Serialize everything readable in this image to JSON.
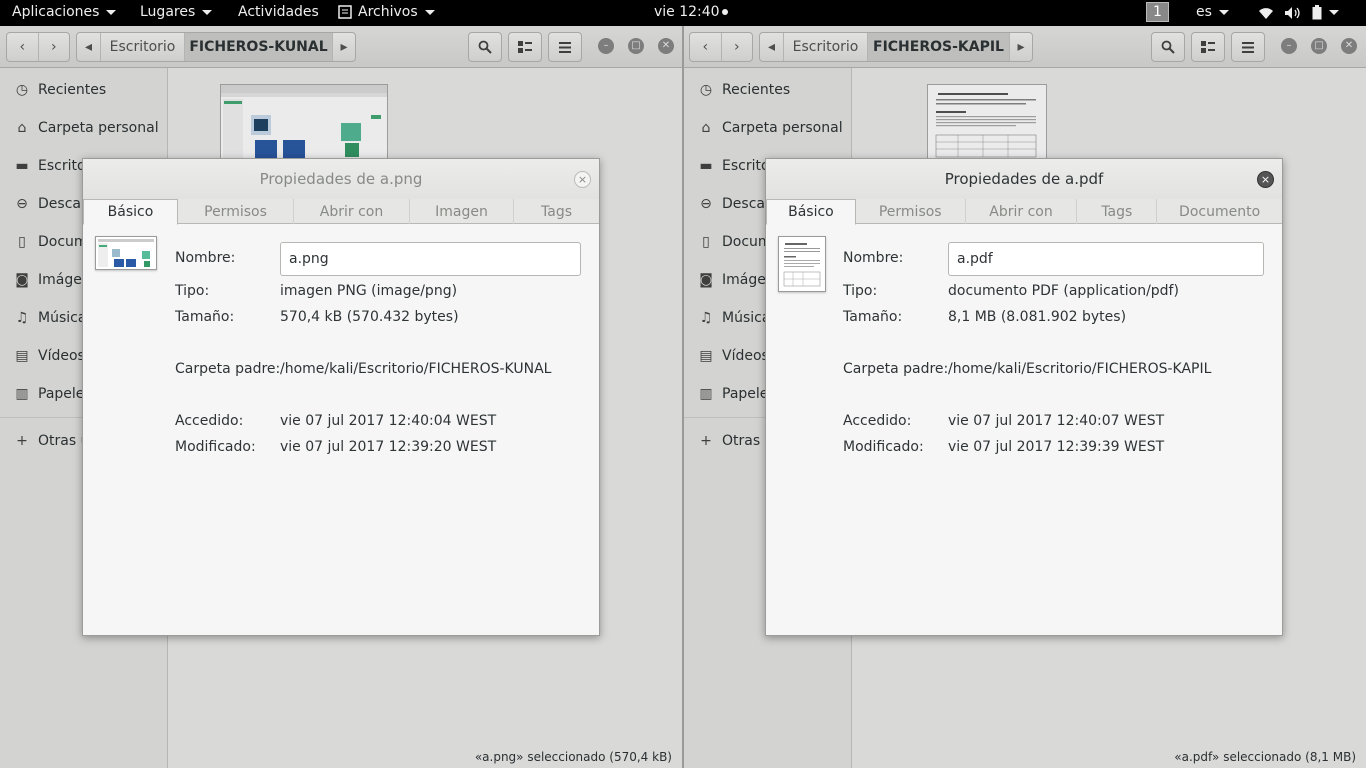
{
  "topbar": {
    "aplicaciones": "Aplicaciones",
    "lugares": "Lugares",
    "actividades": "Actividades",
    "archivos": "Archivos",
    "clock": "vie 12:40",
    "workspace": "1",
    "lang": "es"
  },
  "left": {
    "path_parent": "Escritorio",
    "path_current": "FICHEROS-KUNAL",
    "sidebar": [
      {
        "label": "Recientes",
        "icon": "clock-icon"
      },
      {
        "label": "Carpeta personal",
        "icon": "home-icon"
      },
      {
        "label": "Escritorio",
        "icon": "folder-icon"
      },
      {
        "label": "Descargas",
        "icon": "download-icon"
      },
      {
        "label": "Documentos",
        "icon": "document-icon"
      },
      {
        "label": "Imágenes",
        "icon": "camera-icon"
      },
      {
        "label": "Música",
        "icon": "music-icon"
      },
      {
        "label": "Vídeos",
        "icon": "video-icon"
      },
      {
        "label": "Papelera",
        "icon": "trash-icon"
      },
      {
        "label": "Otras ubicaciones",
        "icon": "plus-icon"
      }
    ],
    "status": "«a.png» seleccionado  (570,4 kB)",
    "dialog": {
      "title": "Propiedades de a.png",
      "tabs": [
        "Básico",
        "Permisos",
        "Abrir con",
        "Imagen",
        "Tags"
      ],
      "name_label": "Nombre:",
      "name_value": "a.png",
      "type_label": "Tipo:",
      "type_value": "imagen PNG (image/png)",
      "size_label": "Tamaño:",
      "size_value": "570,4 kB (570.432 bytes)",
      "parent_label": "Carpeta padre:",
      "parent_value": "/home/kali/Escritorio/FICHEROS-KUNAL",
      "accessed_label": "Accedido:",
      "accessed_value": "vie 07 jul 2017 12:40:04 WEST",
      "modified_label": "Modificado:",
      "modified_value": "vie 07 jul 2017 12:39:20 WEST",
      "close": "×"
    }
  },
  "right": {
    "path_parent": "Escritorio",
    "path_current": "FICHEROS-KAPIL",
    "sidebar": [
      {
        "label": "Recientes",
        "icon": "clock-icon"
      },
      {
        "label": "Carpeta personal",
        "icon": "home-icon"
      },
      {
        "label": "Escritorio",
        "icon": "folder-icon"
      },
      {
        "label": "Descargas",
        "icon": "download-icon"
      },
      {
        "label": "Documentos",
        "icon": "document-icon"
      },
      {
        "label": "Imágenes",
        "icon": "camera-icon"
      },
      {
        "label": "Música",
        "icon": "music-icon"
      },
      {
        "label": "Vídeos",
        "icon": "video-icon"
      },
      {
        "label": "Papelera",
        "icon": "trash-icon"
      },
      {
        "label": "Otras ubicaciones",
        "icon": "plus-icon"
      }
    ],
    "status": "«a.pdf» seleccionado  (8,1 MB)",
    "dialog": {
      "title": "Propiedades de a.pdf",
      "tabs": [
        "Básico",
        "Permisos",
        "Abrir con",
        "Tags",
        "Documento"
      ],
      "name_label": "Nombre:",
      "name_value": "a.pdf",
      "type_label": "Tipo:",
      "type_value": "documento PDF (application/pdf)",
      "size_label": "Tamaño:",
      "size_value": "8,1 MB (8.081.902 bytes)",
      "parent_label": "Carpeta padre:",
      "parent_value": "/home/kali/Escritorio/FICHEROS-KAPIL",
      "accessed_label": "Accedido:",
      "accessed_value": "vie 07 jul 2017 12:40:07 WEST",
      "modified_label": "Modificado:",
      "modified_value": "vie 07 jul 2017 12:39:39 WEST",
      "close": "×"
    }
  }
}
